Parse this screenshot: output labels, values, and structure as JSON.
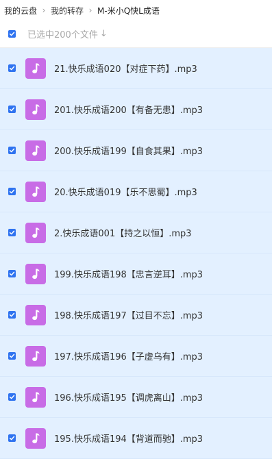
{
  "breadcrumb": {
    "items": [
      "我的云盘",
      "我的转存",
      "M-米小Q快L成语"
    ],
    "separator": "›"
  },
  "toolbar": {
    "selected_text": "已选中200个文件",
    "sort_arrow": "↓"
  },
  "files": [
    {
      "name": "21.快乐成语020【对症下药】.mp3"
    },
    {
      "name": "201.快乐成语200【有备无患】.mp3"
    },
    {
      "name": "200.快乐成语199【自食其果】.mp3"
    },
    {
      "name": "20.快乐成语019【乐不思蜀】.mp3"
    },
    {
      "name": "2.快乐成语001【持之以恒】.mp3"
    },
    {
      "name": "199.快乐成语198【忠言逆耳】.mp3"
    },
    {
      "name": "198.快乐成语197【过目不忘】.mp3"
    },
    {
      "name": "197.快乐成语196【子虚乌有】.mp3"
    },
    {
      "name": "196.快乐成语195【调虎离山】.mp3"
    },
    {
      "name": "195.快乐成语194【背道而驰】.mp3"
    }
  ],
  "icons": {
    "file_icon": "music-note-icon",
    "checkbox": "check-icon"
  },
  "colors": {
    "accent": "#2f73f0",
    "selected_row": "#e3f0ff",
    "audio_icon_bg": "#c86ce6"
  }
}
